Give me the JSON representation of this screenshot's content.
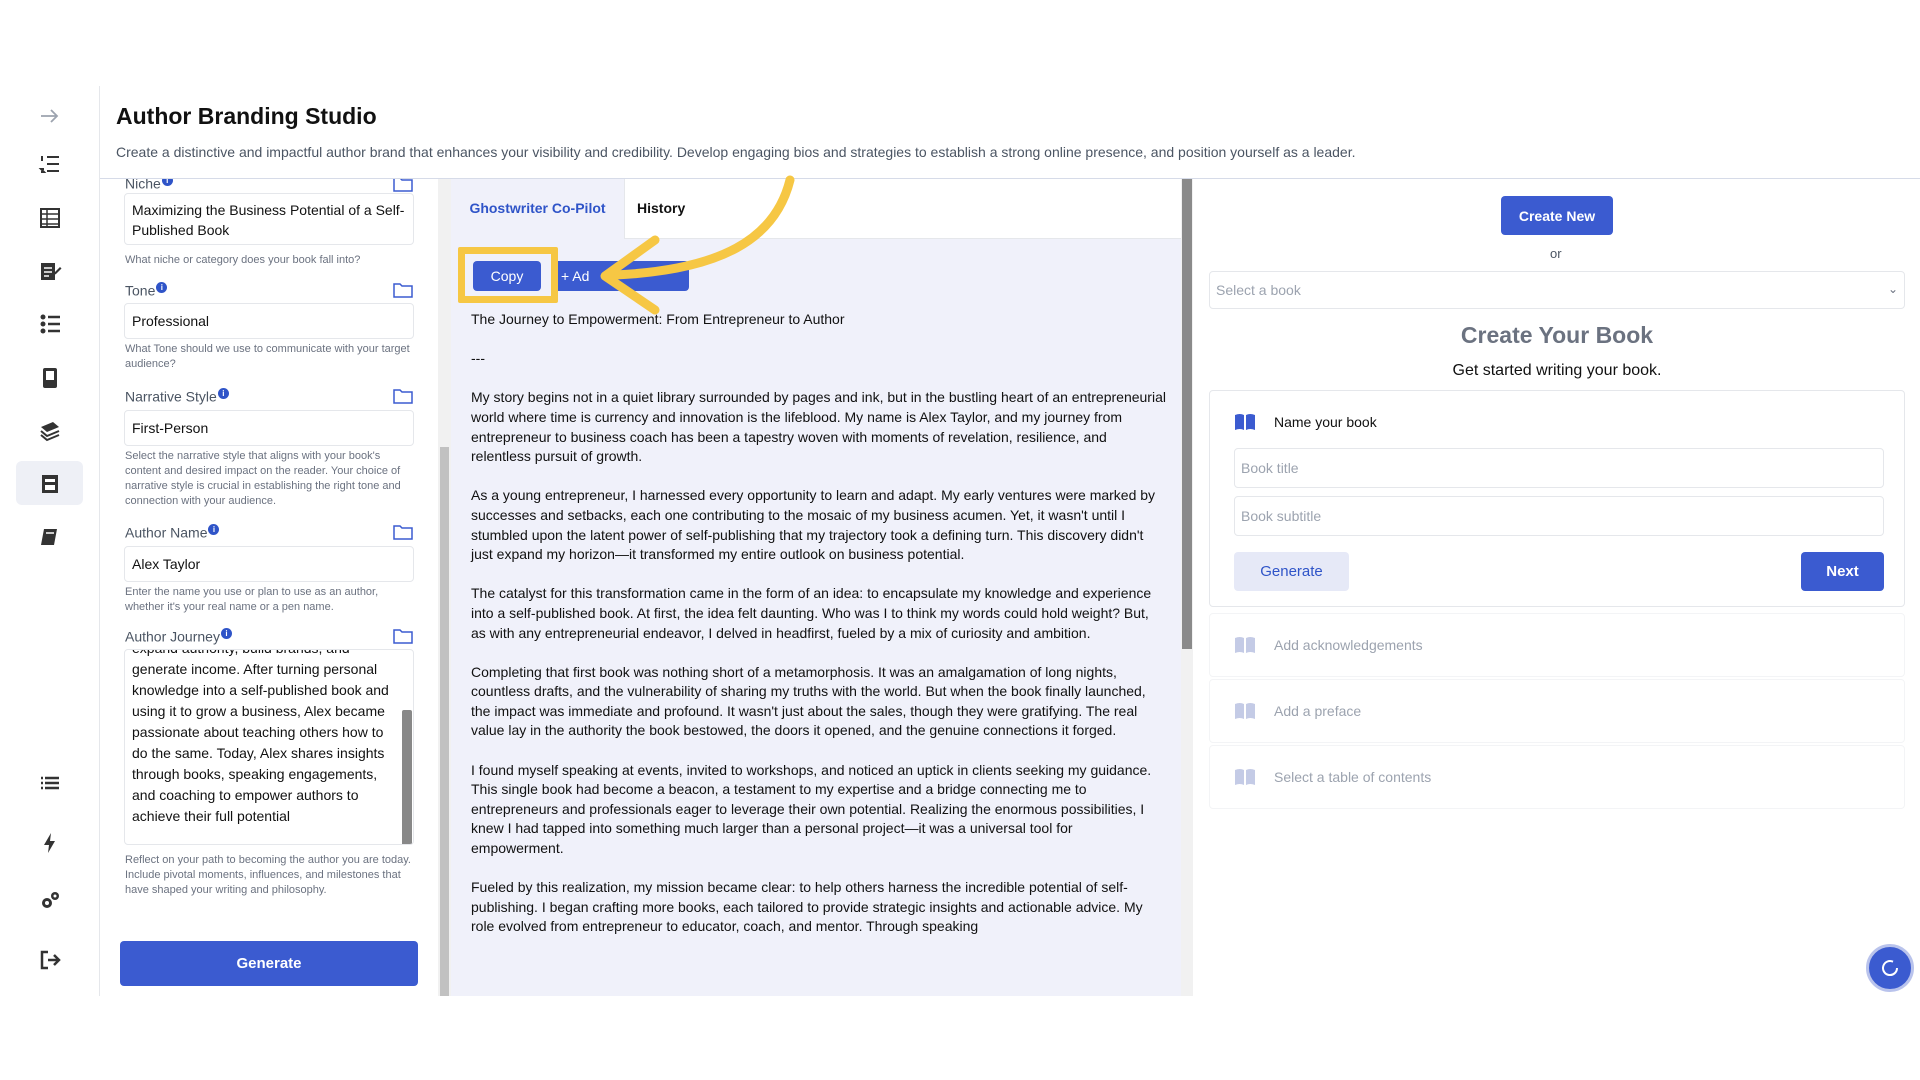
{
  "header": {
    "title": "Author Branding Studio",
    "subtitle": "Create a distinctive and impactful author brand that enhances your visibility and credibility. Develop engaging bios and strategies to establish a strong online presence, and position yourself as a leader."
  },
  "rail": {
    "icons": [
      "arrow-right-icon",
      "numbered-list-icon",
      "table-icon",
      "edit-document-icon",
      "checklist-icon",
      "phone-book-icon",
      "stacked-books-icon",
      "archive-book-icon",
      "closed-book-icon",
      "list-icon",
      "lightning-icon",
      "gears-icon",
      "logout-icon"
    ]
  },
  "form": {
    "niche": {
      "label": "Niche",
      "value": "Maximizing the Business Potential of a Self-Published Book",
      "help": "What niche or category does your book fall into?"
    },
    "tone": {
      "label": "Tone",
      "value": "Professional",
      "help": "What Tone should we use to communicate with your target audience?"
    },
    "narrative_style": {
      "label": "Narrative Style",
      "value": "First-Person",
      "help": "Select the narrative style that aligns with your book's content and desired impact on the reader. Your choice of narrative style is crucial in establishing the right tone and connection with your audience."
    },
    "author_name": {
      "label": "Author Name",
      "value": "Alex Taylor",
      "help": "Enter the name you use or plan to use as an author, whether it's your real name or a pen name."
    },
    "author_journey": {
      "label": "Author Journey",
      "value": "expand authority, build brands, and generate income. After turning personal knowledge into a self-published book and using it to grow a business, Alex became passionate about teaching others how to do the same. Today, Alex shares insights through books, speaking engagements, and coaching to empower authors to achieve their full potential",
      "help": "Reflect on your path to becoming the author you are today. Include pivotal moments, influences, and milestones that have shaped your writing and philosophy."
    },
    "generate_label": "Generate"
  },
  "copilot": {
    "tabs": [
      {
        "label": "Ghostwriter Co-Pilot",
        "active": true
      },
      {
        "label": "History",
        "active": false
      }
    ],
    "copy_label": "Copy",
    "add_label": "+ Ad",
    "document": [
      "The Journey to Empowerment: From Entrepreneur to Author",
      "---",
      "My story begins not in a quiet library surrounded by pages and ink, but in the bustling heart of an entrepreneurial world where time is currency and innovation is the lifeblood. My name is Alex Taylor, and my journey from entrepreneur to business coach has been a tapestry woven with moments of revelation, resilience, and relentless pursuit of growth.",
      "As a young entrepreneur, I harnessed every opportunity to learn and adapt. My early ventures were marked by successes and setbacks, each one contributing to the mosaic of my business acumen. Yet, it wasn't until I stumbled upon the latent power of self-publishing that my trajectory took a defining turn. This discovery didn't just expand my horizon—it transformed my entire outlook on business potential.",
      "The catalyst for this transformation came in the form of an idea: to encapsulate my knowledge and experience into a self-published book. At first, the idea felt daunting. Who was I to think my words could hold weight? But, as with any entrepreneurial endeavor, I delved in headfirst, fueled by a mix of curiosity and ambition.",
      "Completing that first book was nothing short of a metamorphosis. It was an amalgamation of long nights, countless drafts, and the vulnerability of sharing my truths with the world. But when the book finally launched, the impact was immediate and profound. It wasn't just about the sales, though they were gratifying. The real value lay in the authority the book bestowed, the doors it opened, and the genuine connections it forged.",
      "I found myself speaking at events, invited to workshops, and noticed an uptick in clients seeking my guidance. This single book had become a beacon, a testament to my expertise and a bridge connecting me to entrepreneurs and professionals eager to leverage their own potential. Realizing the enormous possibilities, I knew I had tapped into something much larger than a personal project—it was a universal tool for empowerment.",
      "Fueled by this realization, my mission became clear: to help others harness the incredible potential of self-publishing. I began crafting more books, each tailored to provide strategic insights and actionable advice. My role evolved from entrepreneur to educator, coach, and mentor. Through speaking"
    ]
  },
  "right": {
    "create_new_label": "Create New",
    "or_label": "or",
    "select_placeholder": "Select a book",
    "title": "Create Your Book",
    "subtitle": "Get started writing your book.",
    "step1": {
      "label": "Name your book",
      "title_placeholder": "Book title",
      "subtitle_placeholder": "Book subtitle",
      "generate_label": "Generate",
      "next_label": "Next"
    },
    "steps": [
      "Add acknowledgements",
      "Add a preface",
      "Select a table of contents"
    ]
  },
  "colors": {
    "accent": "#3b5bd0",
    "highlight": "#f6c744",
    "panel": "#f0f1fa"
  }
}
